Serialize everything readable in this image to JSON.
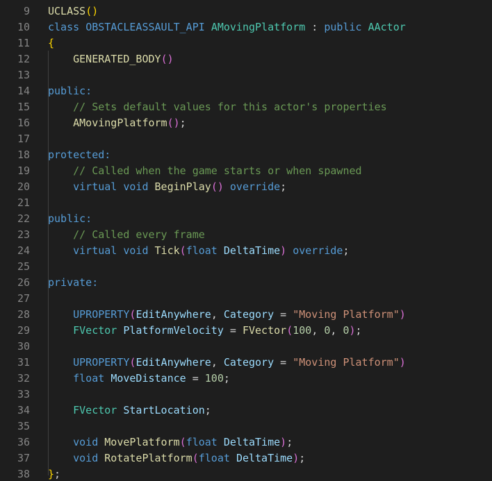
{
  "editor": {
    "language": "cpp",
    "theme_background": "#1e1e1e",
    "lines": [
      {
        "num": "9",
        "tokens": [
          {
            "t": "UCLASS",
            "c": "fn"
          },
          {
            "t": "()",
            "c": "p1"
          }
        ]
      },
      {
        "num": "10",
        "tokens": [
          {
            "t": "class ",
            "c": "kw"
          },
          {
            "t": "OBSTACLEASSAULT_API ",
            "c": "kw"
          },
          {
            "t": "AMovingPlatform",
            "c": "ty"
          },
          {
            "t": " : ",
            "c": "op"
          },
          {
            "t": "public ",
            "c": "kw"
          },
          {
            "t": "AActor",
            "c": "ty"
          }
        ]
      },
      {
        "num": "11",
        "tokens": [
          {
            "t": "{",
            "c": "p1"
          }
        ]
      },
      {
        "num": "12",
        "tokens": [
          {
            "t": "    GENERATED_BODY",
            "c": "fn"
          },
          {
            "t": "()",
            "c": "p2"
          }
        ]
      },
      {
        "num": "13",
        "tokens": []
      },
      {
        "num": "14",
        "tokens": [
          {
            "t": "public:",
            "c": "kw"
          }
        ]
      },
      {
        "num": "15",
        "tokens": [
          {
            "t": "    // Sets default values for this actor's properties",
            "c": "cm"
          }
        ]
      },
      {
        "num": "16",
        "tokens": [
          {
            "t": "    AMovingPlatform",
            "c": "fn"
          },
          {
            "t": "()",
            "c": "p2"
          },
          {
            "t": ";",
            "c": "op"
          }
        ]
      },
      {
        "num": "17",
        "tokens": []
      },
      {
        "num": "18",
        "tokens": [
          {
            "t": "protected:",
            "c": "kw"
          }
        ]
      },
      {
        "num": "19",
        "tokens": [
          {
            "t": "    // Called when the game starts or when spawned",
            "c": "cm"
          }
        ]
      },
      {
        "num": "20",
        "tokens": [
          {
            "t": "    virtual ",
            "c": "kw"
          },
          {
            "t": "void ",
            "c": "kw"
          },
          {
            "t": "BeginPlay",
            "c": "fn"
          },
          {
            "t": "()",
            "c": "p2"
          },
          {
            "t": " override",
            "c": "kw"
          },
          {
            "t": ";",
            "c": "op"
          }
        ]
      },
      {
        "num": "21",
        "tokens": []
      },
      {
        "num": "22",
        "tokens": [
          {
            "t": "public:",
            "c": "kw"
          }
        ]
      },
      {
        "num": "23",
        "tokens": [
          {
            "t": "    // Called every frame",
            "c": "cm"
          }
        ]
      },
      {
        "num": "24",
        "tokens": [
          {
            "t": "    virtual ",
            "c": "kw"
          },
          {
            "t": "void ",
            "c": "kw"
          },
          {
            "t": "Tick",
            "c": "fn"
          },
          {
            "t": "(",
            "c": "p2"
          },
          {
            "t": "float ",
            "c": "kw"
          },
          {
            "t": "DeltaTime",
            "c": "va"
          },
          {
            "t": ")",
            "c": "p2"
          },
          {
            "t": " override",
            "c": "kw"
          },
          {
            "t": ";",
            "c": "op"
          }
        ]
      },
      {
        "num": "25",
        "tokens": []
      },
      {
        "num": "26",
        "tokens": [
          {
            "t": "private:",
            "c": "kw"
          }
        ]
      },
      {
        "num": "27",
        "tokens": []
      },
      {
        "num": "28",
        "tokens": [
          {
            "t": "    UPROPERTY",
            "c": "kw"
          },
          {
            "t": "(",
            "c": "p2"
          },
          {
            "t": "EditAnywhere",
            "c": "va"
          },
          {
            "t": ", ",
            "c": "op"
          },
          {
            "t": "Category",
            "c": "va"
          },
          {
            "t": " = ",
            "c": "op"
          },
          {
            "t": "\"Moving Platform\"",
            "c": "st"
          },
          {
            "t": ")",
            "c": "p2"
          }
        ]
      },
      {
        "num": "29",
        "tokens": [
          {
            "t": "    FVector ",
            "c": "ty"
          },
          {
            "t": "PlatformVelocity",
            "c": "va"
          },
          {
            "t": " = ",
            "c": "op"
          },
          {
            "t": "FVector",
            "c": "fn"
          },
          {
            "t": "(",
            "c": "p2"
          },
          {
            "t": "100",
            "c": "nu"
          },
          {
            "t": ", ",
            "c": "op"
          },
          {
            "t": "0",
            "c": "nu"
          },
          {
            "t": ", ",
            "c": "op"
          },
          {
            "t": "0",
            "c": "nu"
          },
          {
            "t": ")",
            "c": "p2"
          },
          {
            "t": ";",
            "c": "op"
          }
        ]
      },
      {
        "num": "30",
        "tokens": []
      },
      {
        "num": "31",
        "tokens": [
          {
            "t": "    UPROPERTY",
            "c": "kw"
          },
          {
            "t": "(",
            "c": "p2"
          },
          {
            "t": "EditAnywhere",
            "c": "va"
          },
          {
            "t": ", ",
            "c": "op"
          },
          {
            "t": "Category",
            "c": "va"
          },
          {
            "t": " = ",
            "c": "op"
          },
          {
            "t": "\"Moving Platform\"",
            "c": "st"
          },
          {
            "t": ")",
            "c": "p2"
          }
        ]
      },
      {
        "num": "32",
        "tokens": [
          {
            "t": "    float ",
            "c": "kw"
          },
          {
            "t": "MoveDistance",
            "c": "va"
          },
          {
            "t": " = ",
            "c": "op"
          },
          {
            "t": "100",
            "c": "nu"
          },
          {
            "t": ";",
            "c": "op"
          }
        ]
      },
      {
        "num": "33",
        "tokens": []
      },
      {
        "num": "34",
        "tokens": [
          {
            "t": "    FVector ",
            "c": "ty"
          },
          {
            "t": "StartLocation",
            "c": "va"
          },
          {
            "t": ";",
            "c": "op"
          }
        ]
      },
      {
        "num": "35",
        "tokens": []
      },
      {
        "num": "36",
        "tokens": [
          {
            "t": "    void ",
            "c": "kw"
          },
          {
            "t": "MovePlatform",
            "c": "fn"
          },
          {
            "t": "(",
            "c": "p2"
          },
          {
            "t": "float ",
            "c": "kw"
          },
          {
            "t": "DeltaTime",
            "c": "va"
          },
          {
            "t": ")",
            "c": "p2"
          },
          {
            "t": ";",
            "c": "op"
          }
        ]
      },
      {
        "num": "37",
        "tokens": [
          {
            "t": "    void ",
            "c": "kw"
          },
          {
            "t": "RotatePlatform",
            "c": "fn"
          },
          {
            "t": "(",
            "c": "p2"
          },
          {
            "t": "float ",
            "c": "kw"
          },
          {
            "t": "DeltaTime",
            "c": "va"
          },
          {
            "t": ")",
            "c": "p2"
          },
          {
            "t": ";",
            "c": "op"
          }
        ]
      },
      {
        "num": "38",
        "tokens": [
          {
            "t": "}",
            "c": "p1"
          },
          {
            "t": ";",
            "c": "op"
          }
        ]
      }
    ]
  }
}
